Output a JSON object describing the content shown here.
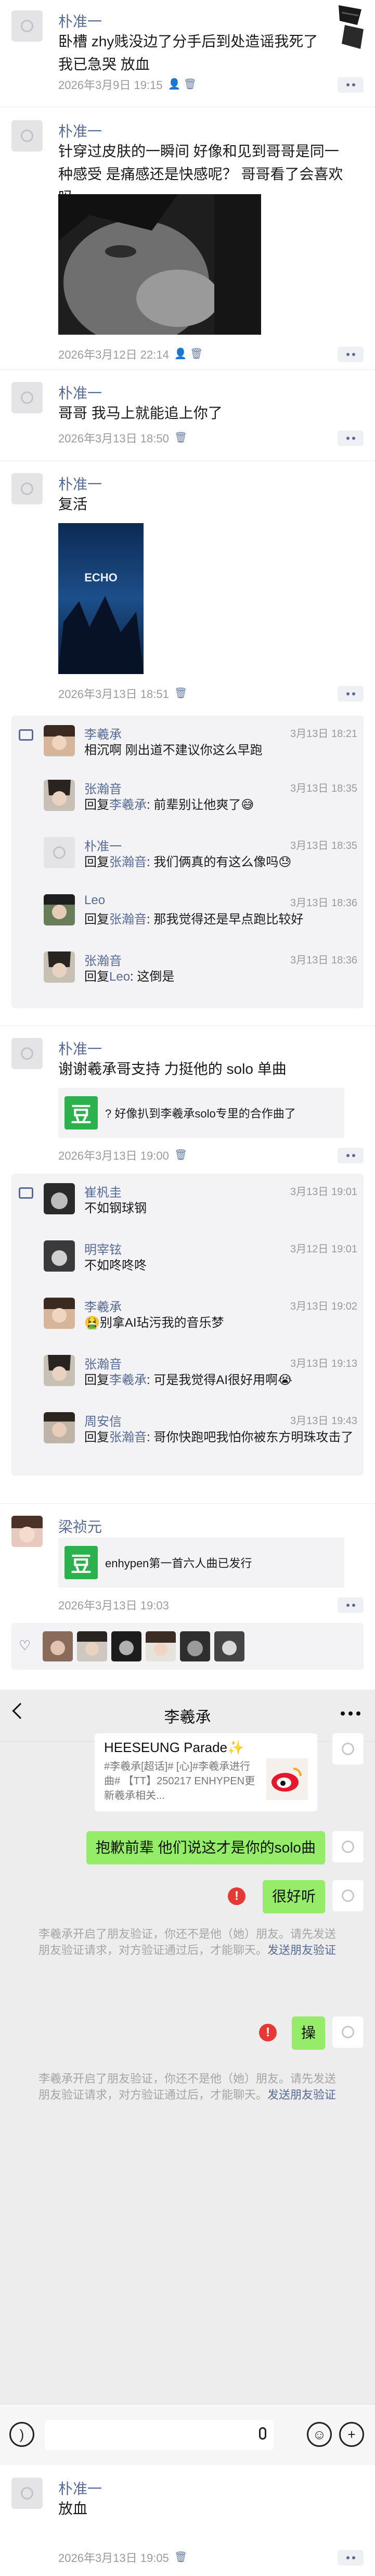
{
  "posts": [
    {
      "author": "朴准一",
      "text": "卧槽 zhy贱没边了分手后到处造谣我死了我已急哭 放血",
      "time": "2026年3月9日 19:15"
    },
    {
      "author": "朴准一",
      "text": "针穿过皮肤的一瞬间 好像和见到哥哥是同一种感受 是痛感还是快感呢？ 哥哥看了会喜欢吗",
      "time": "2026年3月12日 22:14"
    },
    {
      "author": "朴准一",
      "text": "哥哥 我马上就能追上你了",
      "time": "2026年3月13日 18:50"
    },
    {
      "author": "朴准一",
      "text": "复活",
      "time": "2026年3月13日 18:51",
      "image_text": "ECHO",
      "comments": [
        {
          "name": "李羲承",
          "time": "3月13日 18:21",
          "reply_to": "",
          "text": "相沉啊 刚出道不建议你这么早跑"
        },
        {
          "name": "张瀚音",
          "time": "3月13日 18:35",
          "reply_to": "李羲承",
          "text": ": 前辈别让他爽了😅"
        },
        {
          "name": "朴准一",
          "time": "3月13日 18:35",
          "reply_to": "张瀚音",
          "text": ": 我们俩真的有这么像吗😓"
        },
        {
          "name": "Leo",
          "time": "3月13日 18:36",
          "reply_to": "张瀚音",
          "text": ": 那我觉得还是早点跑比较好"
        },
        {
          "name": "张瀚音",
          "time": "3月13日 18:36",
          "reply_to": "Leo",
          "text": ": 这倒是"
        }
      ]
    },
    {
      "author": "朴准一",
      "text": "谢谢羲承哥支持 力挺他的 solo 单曲",
      "time": "2026年3月13日 19:00",
      "share_text": "? 好像扒到李羲承solo专里的合作曲了",
      "comments": [
        {
          "name": "崔杋圭",
          "time": "3月13日 19:01",
          "reply_to": "",
          "text": "不如钢球钢"
        },
        {
          "name": "明宰铉",
          "time": "3月12日 19:01",
          "reply_to": "",
          "text": "不如咚咚咚"
        },
        {
          "name": "李羲承",
          "time": "3月13日 19:02",
          "reply_to": "",
          "text": "🤮别拿AI玷污我的音乐梦"
        },
        {
          "name": "张瀚音",
          "time": "3月13日 19:13",
          "reply_to": "李羲承",
          "text": ": 可是我觉得AI很好用啊😭"
        },
        {
          "name": "周安信",
          "time": "3月13日 19:43",
          "reply_to": "张瀚音",
          "text": ": 哥你快跑吧我怕你被东方明珠攻击了"
        }
      ]
    },
    {
      "author": "梁祯元",
      "share_text": "enhypen第一首六人曲已发行",
      "time": "2026年3月13日 19:03",
      "likes_icon": "heart-icon",
      "like_count": 6
    }
  ],
  "reply_word": "回复",
  "chat": {
    "title": "李羲承",
    "card_title": "HEESEUNG Parade✨",
    "card_body": "#李羲承[超话]# [心]#李羲承进行曲# 【TT】250217 ENHYPEN更新羲承相关...",
    "messages": [
      "抱歉前辈 他们说这才是你的solo曲",
      "很好听",
      "操"
    ],
    "system_notice_main": "李羲承开启了朋友验证，你还不是他（她）朋友。请先发送朋友验证请求，对方验证通过后，才能聊天。",
    "system_notice_link": "发送朋友验证"
  },
  "last_post": {
    "author": "朴准一",
    "text": "放血",
    "time": "2026年3月13日 19:05"
  }
}
